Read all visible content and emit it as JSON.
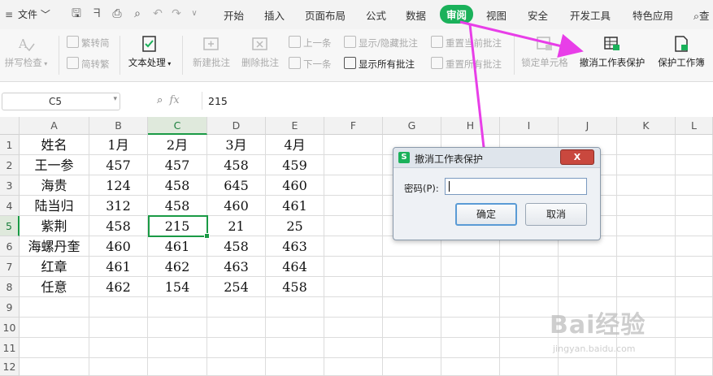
{
  "menu": {
    "file_label": "文件",
    "tabs": [
      "开始",
      "插入",
      "页面布局",
      "公式",
      "数据",
      "审阅",
      "视图",
      "安全",
      "开发工具",
      "特色应用"
    ],
    "active_tab": "审阅",
    "search_label": "查"
  },
  "ribbon": {
    "spellcheck": "拼写检查",
    "trad_to_simp": "繁转简",
    "simp_to_trad": "简转繁",
    "text_process": "文本处理",
    "new_comment": "新建批注",
    "delete_comment": "删除批注",
    "prev": "上一条",
    "next": "下一条",
    "show_hide_comment": "显示/隐藏批注",
    "show_all_comments": "显示所有批注",
    "reset_current_comment": "重置当前批注",
    "reset_all_comments": "重置所有批注",
    "lock_cell": "锁定单元格",
    "unprotect_sheet": "撤消工作表保护",
    "protect_workbook": "保护工作簿"
  },
  "formula_bar": {
    "name_box": "C5",
    "fx": "fx",
    "value": "215"
  },
  "grid": {
    "columns": [
      "A",
      "B",
      "C",
      "D",
      "E",
      "F",
      "G",
      "H",
      "I",
      "J",
      "K",
      "L"
    ],
    "rows": [
      "1",
      "2",
      "3",
      "4",
      "5",
      "6",
      "7",
      "8",
      "9",
      "10",
      "11",
      "12"
    ],
    "selected_col": "C",
    "selected_row": "5",
    "data": [
      [
        "姓名",
        "1月",
        "2月",
        "3月",
        "4月"
      ],
      [
        "王一参",
        "457",
        "457",
        "458",
        "459"
      ],
      [
        "海贵",
        "124",
        "458",
        "645",
        "460"
      ],
      [
        "陆当归",
        "312",
        "458",
        "460",
        "461"
      ],
      [
        "紫荆",
        "458",
        "215",
        "21",
        "25"
      ],
      [
        "海螺丹奎",
        "460",
        "461",
        "458",
        "463"
      ],
      [
        "红章",
        "461",
        "462",
        "463",
        "464"
      ],
      [
        "任意",
        "462",
        "154",
        "254",
        "458"
      ]
    ]
  },
  "dialog": {
    "title": "撤消工作表保护",
    "password_label": "密码(P):",
    "password_value": "",
    "ok_label": "确定",
    "cancel_label": "取消",
    "close_label": "X"
  },
  "watermark": {
    "brand": "Bai经验",
    "url": "jingyan.baidu.com"
  },
  "colors": {
    "accent": "#1ab15a",
    "arrow": "#e83ee8",
    "selection": "#1a9a45"
  }
}
